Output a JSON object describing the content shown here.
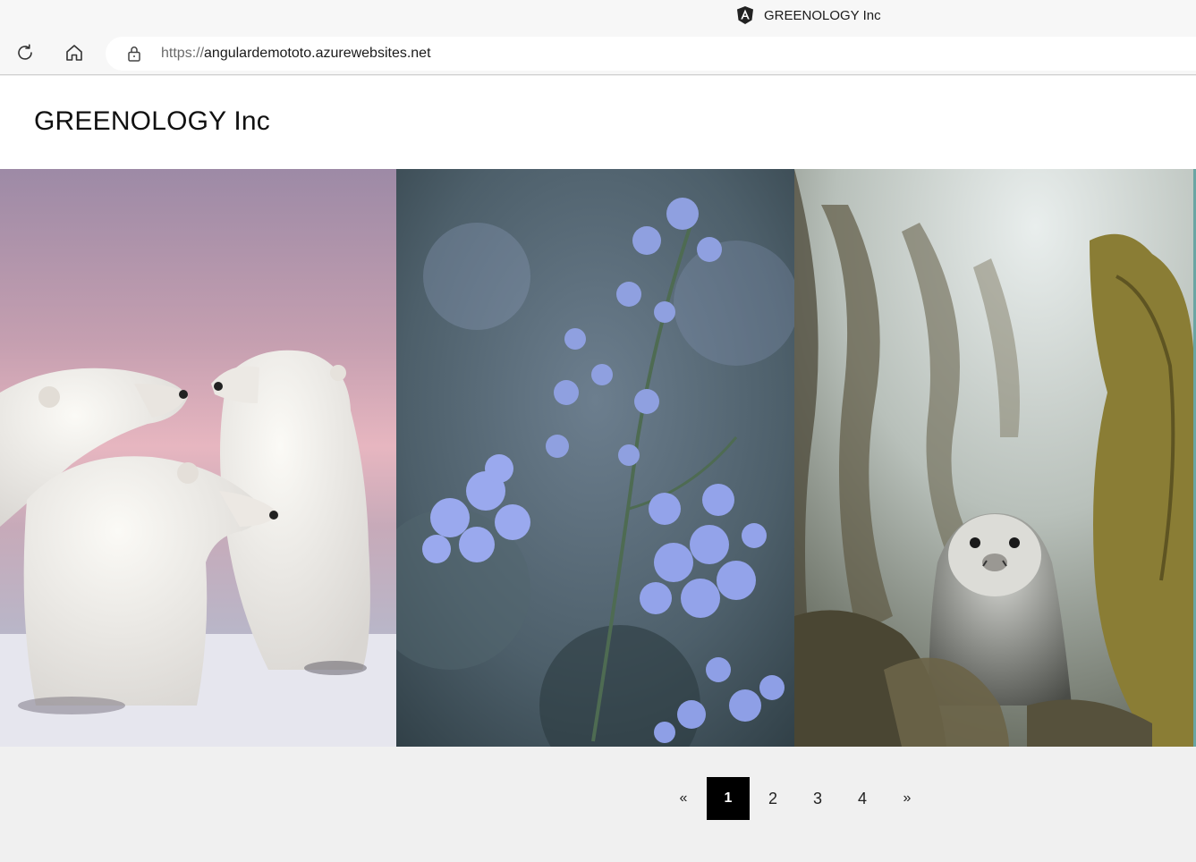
{
  "browser": {
    "tab": {
      "title": "GREENOLOGY Inc",
      "favicon": "angular-icon"
    },
    "toolbar": {
      "refresh_icon": "refresh-icon",
      "home_icon": "home-icon",
      "lock_icon": "lock-icon",
      "url_scheme": "https://",
      "url_host": "angulardemototo.azurewebsites.net"
    }
  },
  "header": {
    "title": "GREENOLOGY Inc"
  },
  "gallery": {
    "photos": [
      {
        "subject": "polar-bears"
      },
      {
        "subject": "blue-flowers"
      },
      {
        "subject": "seal-in-kelp"
      }
    ]
  },
  "pagination": {
    "prev": "«",
    "pages": [
      "1",
      "2",
      "3",
      "4"
    ],
    "active_page": "1",
    "next": "»"
  },
  "colors": {
    "active_page_bg": "#000000",
    "page_bg": "#f0f0f0",
    "header_bg": "#ffffff"
  }
}
